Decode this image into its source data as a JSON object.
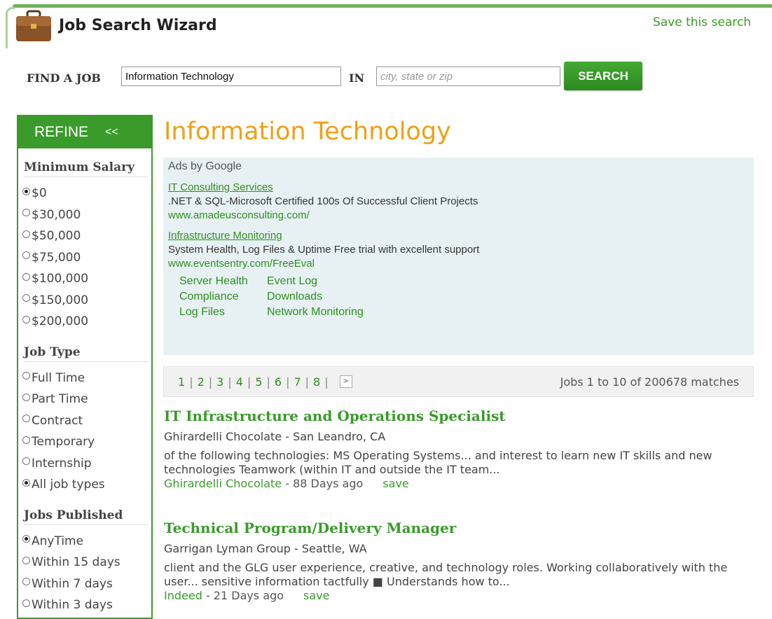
{
  "header": {
    "title": "Job Search Wizard",
    "save_search": "Save this search",
    "icon": "briefcase-icon"
  },
  "search": {
    "find_label": "FIND A JOB",
    "query_value": "Information Technology",
    "in_label": "IN",
    "location_placeholder": "city, state or zip",
    "location_value": "",
    "button_label": "SEARCH"
  },
  "sidebar": {
    "title": "REFINE",
    "collapse": "<<",
    "sections": [
      {
        "title": "Minimum Salary",
        "options": [
          {
            "label": "$0",
            "checked": true
          },
          {
            "label": "$30,000",
            "checked": false
          },
          {
            "label": "$50,000",
            "checked": false
          },
          {
            "label": "$75,000",
            "checked": false
          },
          {
            "label": "$100,000",
            "checked": false
          },
          {
            "label": "$150,000",
            "checked": false
          },
          {
            "label": "$200,000",
            "checked": false
          }
        ]
      },
      {
        "title": "Job Type",
        "options": [
          {
            "label": "Full Time",
            "checked": false
          },
          {
            "label": "Part Time",
            "checked": false
          },
          {
            "label": "Contract",
            "checked": false
          },
          {
            "label": "Temporary",
            "checked": false
          },
          {
            "label": "Internship",
            "checked": false
          },
          {
            "label": "All job types",
            "checked": true
          }
        ]
      },
      {
        "title": "Jobs Published",
        "options": [
          {
            "label": "AnyTime",
            "checked": true
          },
          {
            "label": "Within 15 days",
            "checked": false
          },
          {
            "label": "Within 7 days",
            "checked": false
          },
          {
            "label": "Within 3 days",
            "checked": false
          }
        ]
      }
    ]
  },
  "main": {
    "heading": "Information Technology",
    "ads": {
      "label": "Ads by Google",
      "items": [
        {
          "title": "IT Consulting Services",
          "desc": ".NET & SQL-Microsoft Certified 100s Of Successful Client Projects",
          "url": "www.amadeusconsulting.com/"
        },
        {
          "title": "Infrastructure Monitoring",
          "desc": "System Health, Log Files & Uptime Free trial with excellent support",
          "url": "www.eventsentry.com/FreeEval"
        }
      ],
      "sitelinks": [
        "Server Health",
        "Event Log",
        "Compliance",
        "Downloads",
        "Log Files",
        "Network Monitoring"
      ]
    },
    "pager": {
      "pages": [
        "1",
        "2",
        "3",
        "4",
        "5",
        "6",
        "7",
        "8"
      ],
      "next": ">",
      "count": "Jobs 1 to 10 of 200678 matches"
    },
    "jobs": [
      {
        "title": "IT Infrastructure and Operations Specialist",
        "company": "Ghirardelli Chocolate - San Leandro, CA",
        "snippet": "of the following technologies: MS Operating Systems... and interest to learn new IT skills and new technologies Teamwork (within IT and outside the IT team...",
        "source": "Ghirardelli Chocolate",
        "age": " - 88 Days ago",
        "save": "save"
      },
      {
        "title": "Technical Program/Delivery Manager",
        "company": "Garrigan Lyman Group - Seattle, WA",
        "snippet": "client and the GLG user experience, creative, and technology roles. Working collaboratively with the user... sensitive information tactfully ■ Understands how to...",
        "source": "Indeed",
        "age": " - 21 Days ago",
        "save": "save"
      }
    ]
  }
}
